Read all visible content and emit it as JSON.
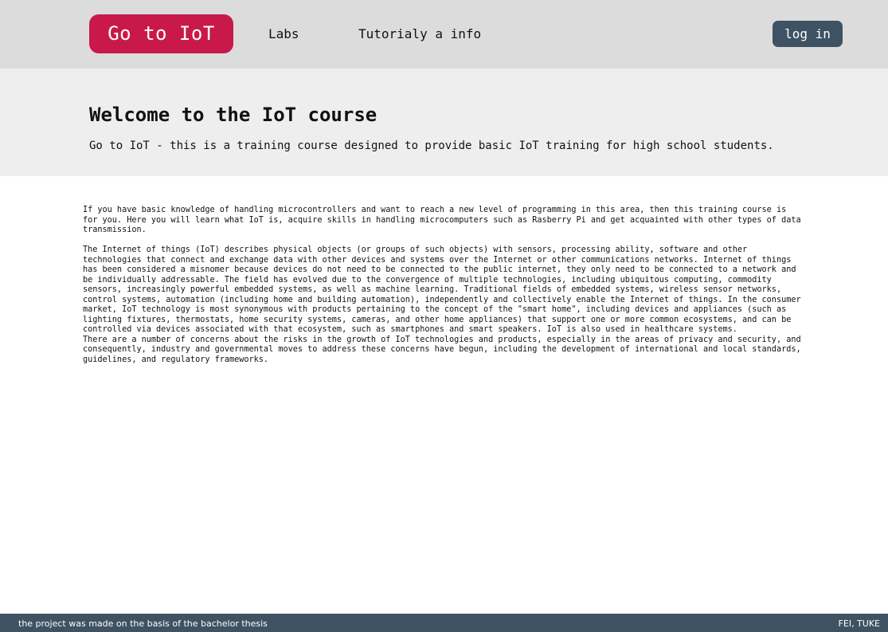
{
  "header": {
    "brand": "Go to IoT",
    "nav": [
      {
        "label": "Labs"
      },
      {
        "label": "Tutorialy a info"
      }
    ],
    "login_label": "log in",
    "colors": {
      "bar_bg": "#dcdcdc",
      "brand_bg": "#c8194a",
      "login_bg": "#3e5263"
    }
  },
  "hero": {
    "title": "Welcome to the IoT course",
    "subtitle": "Go to IoT - this is a training course designed to provide basic IoT training for high school students.",
    "bg": "#eeeeee"
  },
  "content": {
    "intro": "If you have basic knowledge of handling microcontrollers and want to reach a new level of programming in this area, then this training course is for you. Here you will learn what IoT is, acquire skills in handling microcomputers such as Rasberry Pi and get acquainted with other types of data transmission.",
    "description": "The Internet of things (IoT) describes physical objects (or groups of such objects) with sensors, processing ability, software and other technologies that connect and exchange data with other devices and systems over the Internet or other communications networks. Internet of things has been considered a misnomer because devices do not need to be connected to the public internet, they only need to be connected to a network and be individually addressable. The field has evolved due to the convergence of multiple technologies, including ubiquitous computing, commodity sensors, increasingly powerful embedded systems, as well as machine learning. Traditional fields of embedded systems, wireless sensor networks, control systems, automation (including home and building automation), independently and collectively enable the Internet of things. In the consumer market, IoT technology is most synonymous with products pertaining to the concept of the \"smart home\", including devices and appliances (such as lighting fixtures, thermostats, home security systems, cameras, and other home appliances) that support one or more common ecosystems, and can be controlled via devices associated with that ecosystem, such as smartphones and smart speakers. IoT is also used in healthcare systems.",
    "concerns": "There are a number of concerns about the risks in the growth of IoT technologies and products, especially in the areas of privacy and security, and consequently, industry and governmental moves to address these concerns have begun, including the development of international and local standards, guidelines, and regulatory frameworks."
  },
  "footer": {
    "left": "the project was made on the basis of the bachelor thesis",
    "right": "FEI, TUKE",
    "bg": "#3e5263"
  }
}
